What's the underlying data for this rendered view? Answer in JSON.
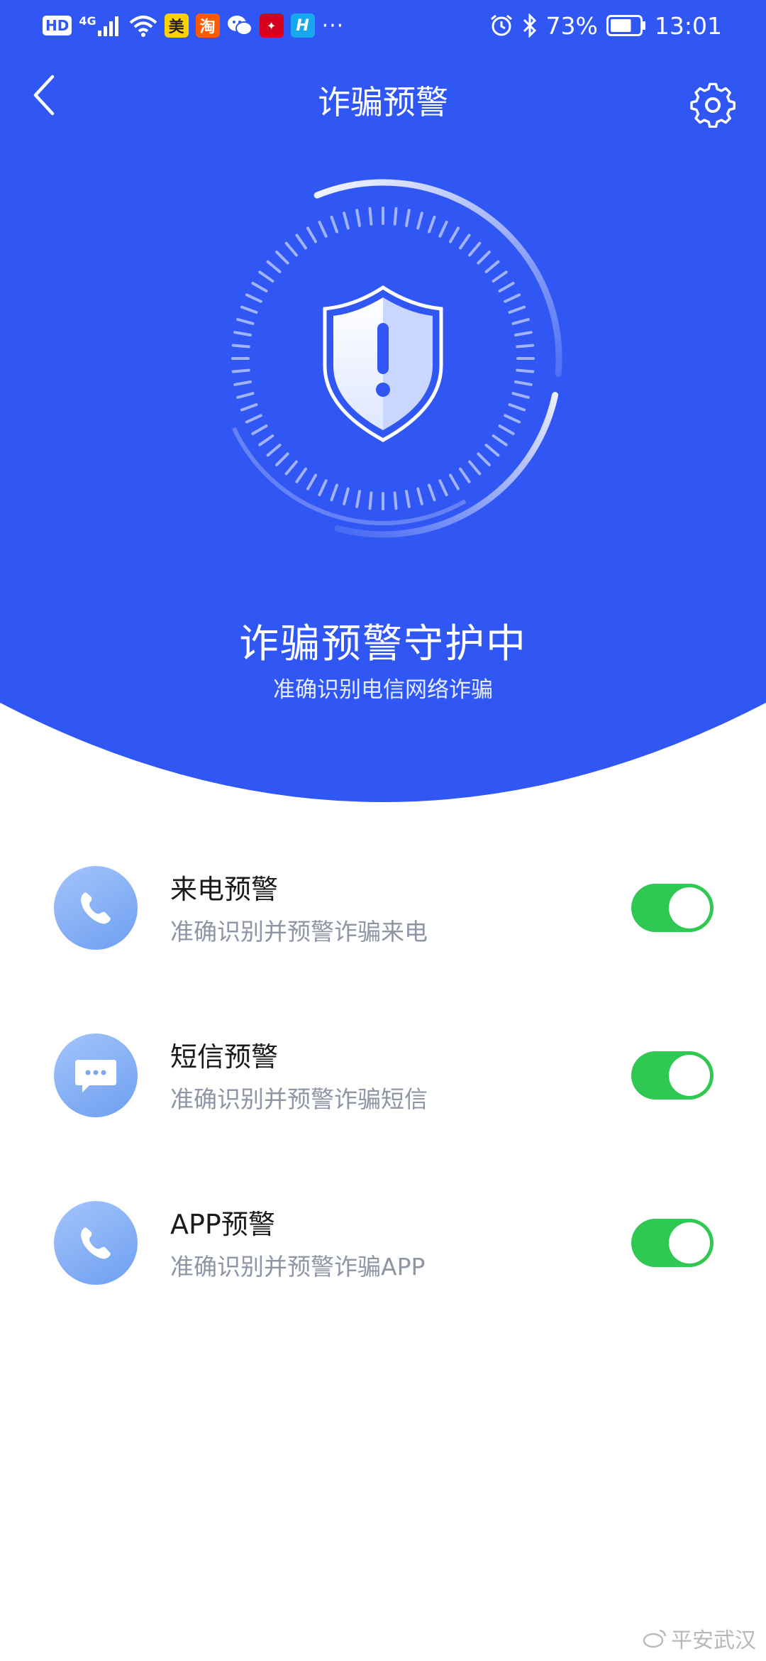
{
  "colors": {
    "brand_blue": "#3057f3",
    "toggle_on": "#2fc853",
    "icon_bg": "#8fb4f7"
  },
  "status_bar": {
    "hd": "HD",
    "network": "4G",
    "app_icons": [
      "美",
      "淘",
      "wechat-icon",
      "news-icon",
      "H"
    ],
    "more": "···",
    "battery": "73%",
    "time": "13:01"
  },
  "header": {
    "title": "诈骗预警",
    "back_icon": "chevron-left-icon",
    "settings_icon": "gear-icon"
  },
  "hero": {
    "status_title": "诈骗预警守护中",
    "status_subtitle": "准确识别电信网络诈骗",
    "shield_icon": "shield-exclamation-icon"
  },
  "settings": [
    {
      "title": "来电预警",
      "desc": "准确识别并预警诈骗来电",
      "icon": "phone-icon",
      "enabled": true
    },
    {
      "title": "短信预警",
      "desc": "准确识别并预警诈骗短信",
      "icon": "message-icon",
      "enabled": true
    },
    {
      "title": "APP预警",
      "desc": "准确识别并预警诈骗APP",
      "icon": "phone-icon",
      "enabled": true
    }
  ],
  "watermark": "平安武汉"
}
